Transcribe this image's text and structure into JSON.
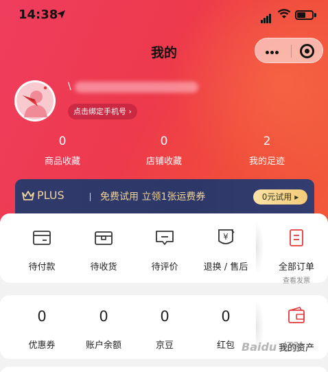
{
  "status_bar": {
    "time": "14:38"
  },
  "header": {
    "title": "我的"
  },
  "capsule": {
    "more_icon": "more-dots-icon",
    "close_icon": "target-close-icon"
  },
  "profile": {
    "username_visible": "\\",
    "bind_phone": "点击绑定手机号 ›"
  },
  "stats": [
    {
      "value": "0",
      "label": "商品收藏"
    },
    {
      "value": "0",
      "label": "店铺收藏"
    },
    {
      "value": "2",
      "label": "我的足迹"
    }
  ],
  "plus": {
    "logo": "PLUS",
    "promo": "免费试用 立领1张运费券",
    "button": "0元试用 ▸",
    "accent": "#f2d59a",
    "bg": "#2f3a6b"
  },
  "orders": {
    "items": [
      {
        "label": "待付款",
        "icon": "card-icon"
      },
      {
        "label": "待收货",
        "icon": "box-icon"
      },
      {
        "label": "待评价",
        "icon": "comment-icon"
      },
      {
        "label": "退换 / 售后",
        "icon": "refund-icon"
      }
    ],
    "all": {
      "label": "全部订单",
      "sub": "查看发票",
      "icon": "order-list-icon"
    }
  },
  "assets": {
    "items": [
      {
        "value": "0",
        "label": "优惠券"
      },
      {
        "value": "0",
        "label": "账户余额"
      },
      {
        "value": "0",
        "label": "京豆"
      },
      {
        "value": "0",
        "label": "红包"
      }
    ],
    "all": {
      "label": "我的资产",
      "icon": "wallet-icon"
    }
  },
  "watermark": "Baidu 经验",
  "colors": {
    "brand_red": "#ee3a4c",
    "icon_red": "#e4393c"
  }
}
